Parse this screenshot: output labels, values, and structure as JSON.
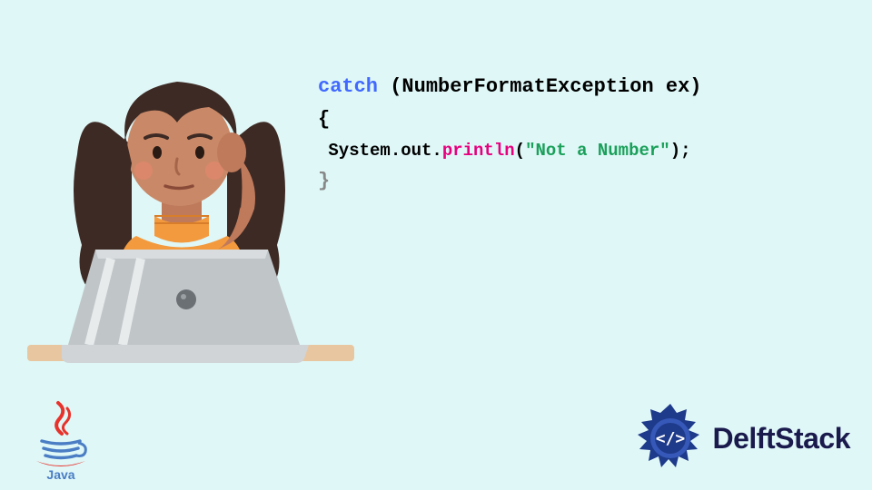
{
  "code": {
    "line1_kw": "catch",
    "line1_rest": " (NumberFormatException ex)",
    "line2": "{",
    "line3_prefix": " System.out.",
    "line3_method": "println",
    "line3_paren_open": "(",
    "line3_string": "\"Not a Number\"",
    "line3_paren_close": ");",
    "line4": "}"
  },
  "logos": {
    "java_label": "Java",
    "delft_label": "DelftStack"
  },
  "colors": {
    "bg": "#dff7f7",
    "keyword": "#4169ff",
    "method": "#e6007e",
    "string": "#1aa05a",
    "delft_blue": "#1e3a8a"
  }
}
